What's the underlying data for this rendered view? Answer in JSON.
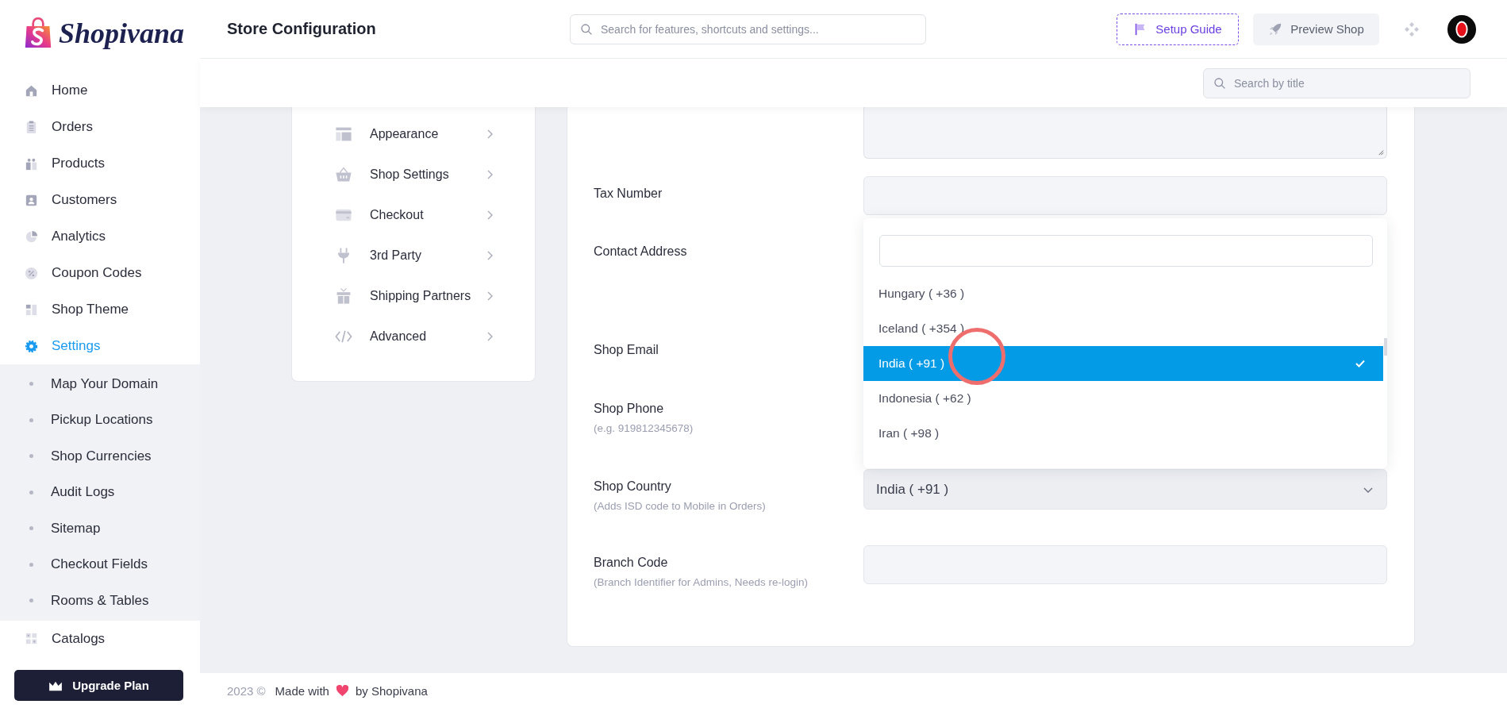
{
  "brand": {
    "name": "Shopivana"
  },
  "sidebar": {
    "items": [
      {
        "label": "Home",
        "selected": false
      },
      {
        "label": "Orders",
        "selected": false
      },
      {
        "label": "Products",
        "selected": false
      },
      {
        "label": "Customers",
        "selected": false
      },
      {
        "label": "Analytics",
        "selected": false
      },
      {
        "label": "Coupon Codes",
        "selected": false
      },
      {
        "label": "Shop Theme",
        "selected": false
      },
      {
        "label": "Settings",
        "selected": true,
        "expanded": true,
        "children": [
          {
            "label": "Map Your Domain"
          },
          {
            "label": "Pickup Locations"
          },
          {
            "label": "Shop Currencies"
          },
          {
            "label": "Audit Logs"
          },
          {
            "label": "Sitemap"
          },
          {
            "label": "Checkout Fields"
          },
          {
            "label": "Rooms & Tables"
          }
        ]
      },
      {
        "label": "Catalogs",
        "selected": false
      }
    ]
  },
  "upgrade_button": "Upgrade Plan",
  "header": {
    "title": "Store Configuration",
    "search": {
      "placeholder": "Search for features, shortcuts and settings..."
    },
    "setup_guide": "Setup Guide",
    "preview_shop": "Preview Shop"
  },
  "subheader": {
    "search": {
      "placeholder": "Search by title"
    }
  },
  "settings_menu": {
    "items": [
      {
        "label": "Appearance"
      },
      {
        "label": "Shop Settings"
      },
      {
        "label": "Checkout"
      },
      {
        "label": "3rd Party"
      },
      {
        "label": "Shipping Partners"
      },
      {
        "label": "Advanced"
      }
    ]
  },
  "form": {
    "rows": [
      {
        "kind": "textarea"
      },
      {
        "label": "Tax Number",
        "kind": "text"
      },
      {
        "label": "Contact Address"
      },
      {
        "label": "Shop Email"
      },
      {
        "label": "Shop Phone",
        "hint": "(e.g. 919812345678)"
      },
      {
        "label": "Shop Country",
        "hint": "(Adds ISD code to Mobile in Orders)",
        "kind": "select",
        "value": "India ( +91 )",
        "dropdown": {
          "open": true,
          "options": [
            {
              "label": "Hungary ( +36 )",
              "selected": false
            },
            {
              "label": "Iceland ( +354 )",
              "selected": false
            },
            {
              "label": "India ( +91 )",
              "selected": true
            },
            {
              "label": "Indonesia ( +62 )",
              "selected": false
            },
            {
              "label": "Iran ( +98 )",
              "selected": false
            }
          ]
        }
      },
      {
        "label": "Branch Code",
        "hint": "(Branch Identifier for Admins, Needs re-login)",
        "kind": "text"
      }
    ]
  },
  "footer": {
    "year": "2023 ©",
    "made_with": "Made with",
    "by": "by Shopivana"
  }
}
